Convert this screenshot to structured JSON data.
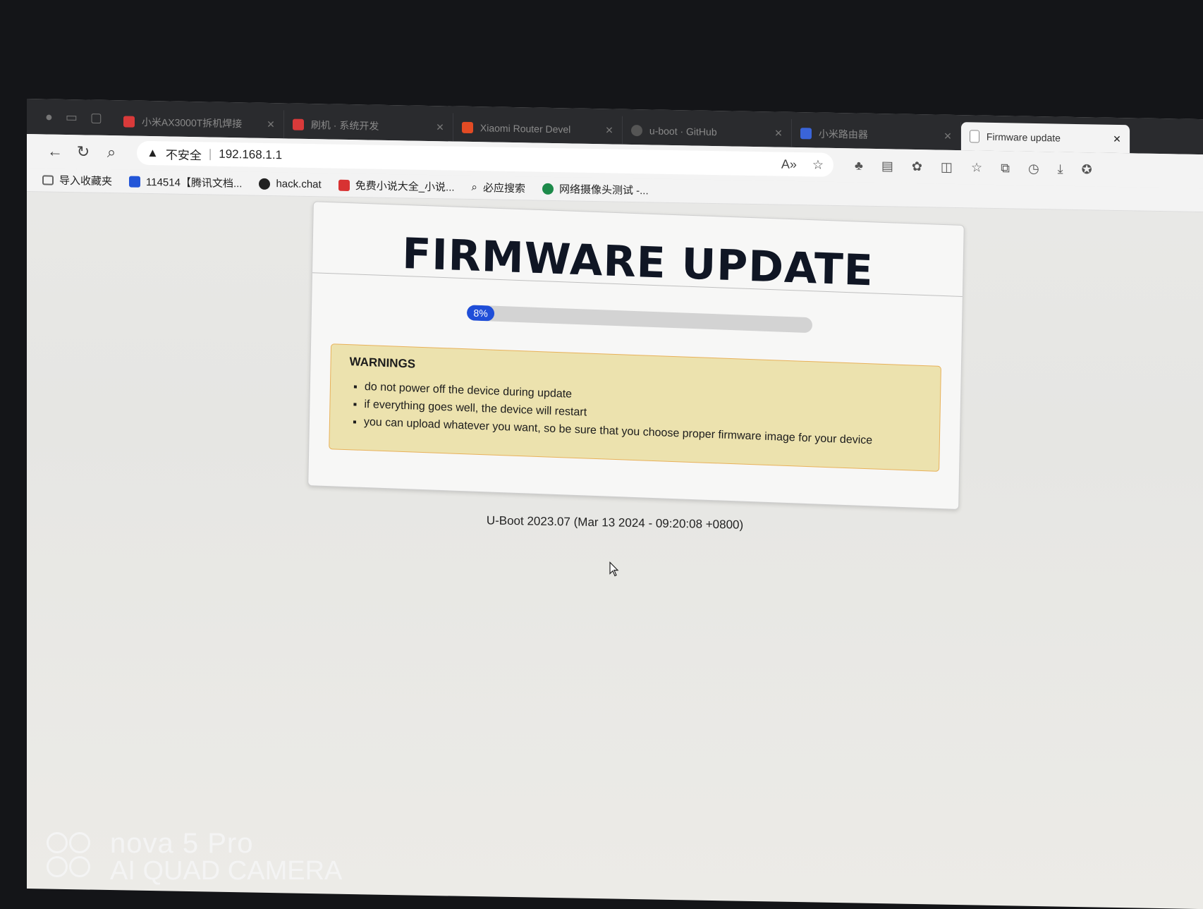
{
  "browser": {
    "tabs": [
      {
        "label": "小米AX3000T拆机焊接",
        "color": "#d93a3a"
      },
      {
        "label": "刷机 · 系统开发",
        "color": "#d93a3a"
      },
      {
        "label": "Xiaomi Router Devel",
        "color": "#e24b24"
      },
      {
        "label": "u-boot · GitHub",
        "color": "#555555"
      },
      {
        "label": "小米路由器",
        "color": "#3a64d8"
      },
      {
        "label": "Firmware update",
        "color": "#888888",
        "active": true
      }
    ],
    "security_label": "不安全",
    "url": "192.168.1.1",
    "bookmarks": [
      {
        "label": "导入收藏夹",
        "color": "#666666"
      },
      {
        "label": "114514【腾讯文档...",
        "color": "#2356d8"
      },
      {
        "label": "hack.chat",
        "color": "#222222"
      },
      {
        "label": "免费小说大全_小说...",
        "color": "#d83232"
      },
      {
        "label": "必应搜索",
        "color": "#444444"
      },
      {
        "label": "网络摄像头测试 -...",
        "color": "#1d8a4a"
      }
    ]
  },
  "page": {
    "title": "FIRMWARE UPDATE",
    "progress": {
      "percent": 8,
      "label": "8%"
    },
    "warnings_title": "WARNINGS",
    "warnings": [
      "do not power off the device during update",
      "if everything goes well, the device will restart",
      "you can upload whatever you want, so be sure that you choose proper firmware image for your device"
    ],
    "footer": "U-Boot 2023.07 (Mar 13 2024 - 09:20:08 +0800)"
  },
  "watermark": {
    "line1": "nova 5 Pro",
    "line2": "AI QUAD CAMERA"
  },
  "colors": {
    "progress_fill": "#1f4ed8",
    "warning_bg": "#ece2ae",
    "warning_border": "#e8b15a"
  }
}
